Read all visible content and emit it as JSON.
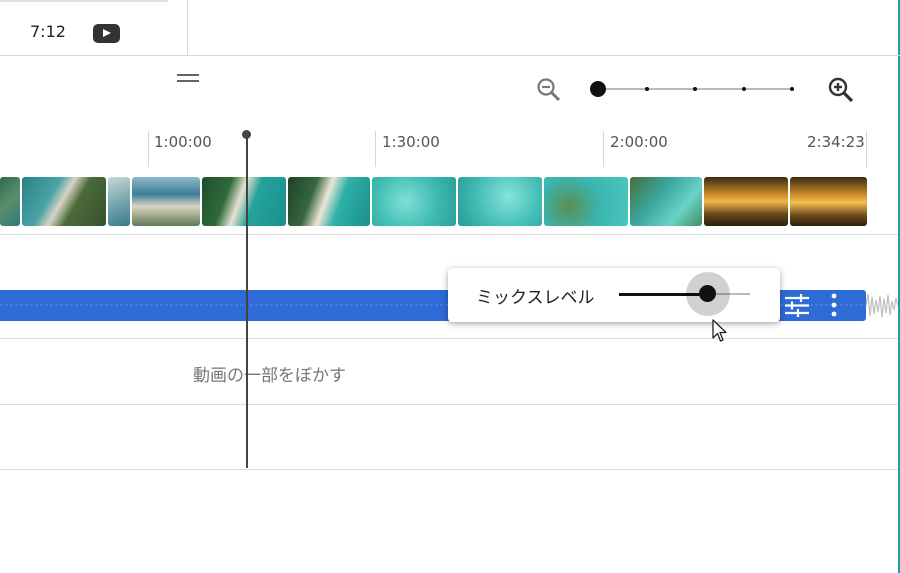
{
  "header": {
    "duration": "7:12",
    "youtube_icon": "youtube-icon"
  },
  "zoom": {
    "zoom_out_icon": "zoom-out-icon",
    "zoom_in_icon": "zoom-in-icon",
    "level": 0
  },
  "timeline": {
    "ruler_labels": [
      "1:00:00",
      "1:30:00",
      "2:00:00",
      "2:34:23"
    ],
    "video_track": {
      "thumbnails": [
        "aerial-coast",
        "aerial-coast",
        "aerial-beach",
        "aerial-beach",
        "aerial-coast",
        "aerial-beach",
        "turquoise-sea",
        "turquoise-sea",
        "turquoise-reef",
        "turquoise-reef",
        "green-shore",
        "sunset",
        "sunset"
      ]
    },
    "audio_track": {
      "color": "#2f6bd6",
      "tune_icon": "tune-icon",
      "more_icon": "more-vertical-icon"
    },
    "blur_track": {
      "label": "動画の一部をぼかす"
    }
  },
  "mix_popup": {
    "label": "ミックスレベル",
    "value_fraction": 0.68
  },
  "colors": {
    "accent_blue": "#2f6bd6",
    "frame_border": "#1aa0a8"
  }
}
